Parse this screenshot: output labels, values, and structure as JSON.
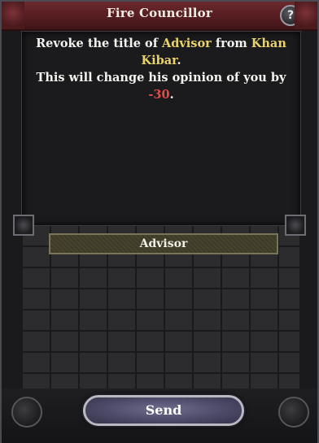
{
  "dialog": {
    "title": "Fire Councillor",
    "help_label": "?",
    "message": {
      "line1_pre": "Revoke the title of ",
      "title_name": "Advisor",
      "line1_mid": " from ",
      "character_name": "Khan Kibar",
      "line1_post": ".",
      "line2_pre": "This will change his opinion of you by ",
      "opinion_change": "-30",
      "line2_post": "."
    },
    "selected_title": "Advisor",
    "send_label": "Send"
  },
  "colors": {
    "banner": "#5a1f23",
    "highlight_name": "#e9d36a",
    "negative_value": "#e24a4a",
    "send_button": "#4c4a67"
  },
  "icons": {
    "help": "question-mark-icon"
  }
}
